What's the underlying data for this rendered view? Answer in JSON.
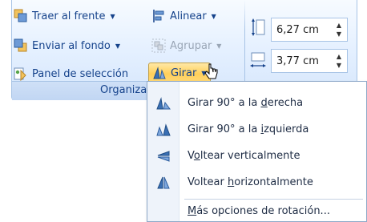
{
  "ribbon": {
    "group_label": "Organiza",
    "buttons": {
      "bring_front": "Traer al frente",
      "send_back": "Enviar al fondo",
      "selection_pane": "Panel de selección",
      "align": "Alinear",
      "group": "Agrupar",
      "rotate": "Girar"
    },
    "size": {
      "height_value": "6,27 cm",
      "width_value": "3,77 cm"
    }
  },
  "menu": {
    "items": [
      {
        "pre": "Girar 90° a la ",
        "key": "d",
        "post": "erecha",
        "icon": "rotate-right-icon"
      },
      {
        "pre": "Girar 90° a la ",
        "key": "i",
        "post": "zquierda",
        "icon": "rotate-left-icon"
      },
      {
        "pre": "V",
        "key": "o",
        "post": "ltear verticalmente",
        "icon": "flip-vertical-icon"
      },
      {
        "pre": "Voltear ",
        "key": "h",
        "post": "orizontalmente",
        "icon": "flip-horizontal-icon"
      },
      {
        "pre": "",
        "key": "M",
        "post": "ás opciones de rotación...",
        "icon": ""
      }
    ]
  },
  "colors": {
    "ribbon_text": "#15428b",
    "pressed_button": "#ffcf5a",
    "menu_gutter": "#eef3fa"
  }
}
